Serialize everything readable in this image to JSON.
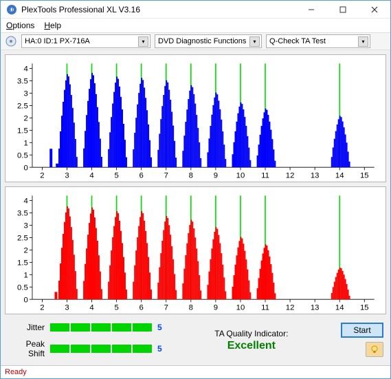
{
  "titlebar": {
    "text": "PlexTools Professional XL V3.16"
  },
  "menu": {
    "options": "Options",
    "help": "Help"
  },
  "toolbar": {
    "drive": "HA:0 ID:1  PX-716A",
    "functions": "DVD Diagnostic Functions",
    "test": "Q-Check TA Test"
  },
  "meters": {
    "jitter_label": "Jitter",
    "jitter_value": "5",
    "jitter_segments_on": 5,
    "jitter_segments_total": 5,
    "peak_label": "Peak Shift",
    "peak_value": "5",
    "peak_segments_on": 5,
    "peak_segments_total": 5
  },
  "ta": {
    "label": "TA Quality Indicator:",
    "value": "Excellent"
  },
  "buttons": {
    "start": "Start"
  },
  "status": "Ready",
  "colors": {
    "top_chart": "#0000ff",
    "bottom_chart": "#ff0000",
    "marker": "#00e000",
    "meter_on": "#00d400",
    "ta_value": "#008000"
  },
  "chart_data": [
    {
      "type": "bar",
      "color": "blue",
      "xticks": [
        2,
        3,
        4,
        5,
        6,
        7,
        8,
        9,
        10,
        11,
        12,
        13,
        14,
        15
      ],
      "yticks": [
        0,
        0.5,
        1,
        1.5,
        2,
        2.5,
        3,
        3.5,
        4
      ],
      "ylim": [
        0,
        4.2
      ],
      "markers_x": [
        3,
        4,
        5,
        6,
        7,
        8,
        9,
        10,
        11,
        14
      ],
      "peaks": [
        {
          "x": 3,
          "y": 3.8
        },
        {
          "x": 4,
          "y": 3.85
        },
        {
          "x": 5,
          "y": 3.7
        },
        {
          "x": 6,
          "y": 3.65
        },
        {
          "x": 7,
          "y": 3.55
        },
        {
          "x": 8,
          "y": 3.35
        },
        {
          "x": 9,
          "y": 3.05
        },
        {
          "x": 10,
          "y": 2.65
        },
        {
          "x": 11,
          "y": 2.4
        },
        {
          "x": 14,
          "y": 2.1
        }
      ],
      "half_width": 0.4,
      "small_bars": [
        {
          "x": 2.3,
          "y": 0.75
        },
        {
          "x": 2.55,
          "y": 0.15
        }
      ]
    },
    {
      "type": "bar",
      "color": "red",
      "xticks": [
        2,
        3,
        4,
        5,
        6,
        7,
        8,
        9,
        10,
        11,
        12,
        13,
        14,
        15
      ],
      "yticks": [
        0,
        0.5,
        1,
        1.5,
        2,
        2.5,
        3,
        3.5,
        4
      ],
      "ylim": [
        0,
        4.2
      ],
      "markers_x": [
        3,
        4,
        5,
        6,
        7,
        8,
        9,
        10,
        11,
        14
      ],
      "peaks": [
        {
          "x": 3,
          "y": 3.8
        },
        {
          "x": 4,
          "y": 3.75
        },
        {
          "x": 5,
          "y": 3.6
        },
        {
          "x": 6,
          "y": 3.6
        },
        {
          "x": 7,
          "y": 3.4
        },
        {
          "x": 8,
          "y": 3.25
        },
        {
          "x": 9,
          "y": 2.95
        },
        {
          "x": 10,
          "y": 2.55
        },
        {
          "x": 11,
          "y": 2.25
        },
        {
          "x": 14,
          "y": 1.3
        }
      ],
      "half_width": 0.4,
      "small_bars": [
        {
          "x": 2.5,
          "y": 0.3
        }
      ]
    }
  ]
}
